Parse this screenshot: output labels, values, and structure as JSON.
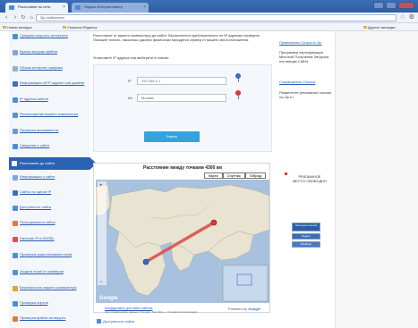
{
  "browser": {
    "tabs": [
      {
        "label": "Расстояние по сети"
      },
      {
        "label": "Яндекс.Интернетометр"
      }
    ],
    "url": "2ip.ru/distance/",
    "bookmarks": [
      {
        "label": "Новая вкладка"
      },
      {
        "label": "Сервисы Яндекса"
      },
      {
        "label": "Другие закладки"
      }
    ]
  },
  "leftnav": {
    "items": [
      {
        "label": "Средняя скорость интернета",
        "icon_color": "#4a8fd8"
      },
      {
        "label": "Время загрузки файла",
        "icon_color": "#7fa7d9"
      },
      {
        "label": "Объем интернет-трафика",
        "icon_color": "#9aaec9"
      },
      {
        "label": "Информация об IP адресе или домене",
        "icon_color": "#3b6fbf"
      },
      {
        "label": "IP адреса сайтов",
        "icon_color": "#4a8fd8"
      },
      {
        "label": "Расположение вашего компьютера",
        "icon_color": "#5b8fd0"
      },
      {
        "label": "Проверка анонимности",
        "icon_color": "#6b9ad6"
      },
      {
        "label": "Сведения о сайте",
        "icon_color": "#4a8fd8"
      },
      {
        "label": "Расстояние до сайта",
        "icon_color": "#ffffff"
      },
      {
        "label": "Информация о сайте",
        "icon_color": "#7fa7d9"
      },
      {
        "label": "Сайты на одном IP",
        "icon_color": "#3b6fbf"
      },
      {
        "label": "Доступность сайта",
        "icon_color": "#4a8fd8"
      },
      {
        "label": "Посещаемость сайта",
        "icon_color": "#e07b39"
      },
      {
        "label": "Наличие IP в DNSBL",
        "icon_color": "#d9534f"
      },
      {
        "label": "Проверка существования email",
        "icon_color": "#4a8fd8"
      },
      {
        "label": "Защита email от спамеров",
        "icon_color": "#5b8fd0"
      },
      {
        "label": "Безопасность вашего компьютера",
        "icon_color": "#e0a53a"
      },
      {
        "label": "Проверка портов",
        "icon_color": "#4a8fd8"
      },
      {
        "label": "Проверка файла на вирусы",
        "icon_color": "#e07b39"
      }
    ]
  },
  "content": {
    "intro": "Расстояние от вашего компьютера до сайта. Вычисляется приблизительно по IP адресам серверов. Поможет понять, насколько далеко физически находится сервер от вашего местоположения.",
    "instruction": "Установите IP адреса или выберите в списке:",
    "ip1": "192.168.1.1",
    "ip2": "Москва",
    "ip1_label": "IP",
    "ip2_label": "Из",
    "find_button": "Узнать",
    "map_title": "Расстояние между точками 4300 км",
    "map_buttons": [
      "Карта",
      "Спутник",
      "Гибрид"
    ],
    "map_footer_link": "Координаты для Web сайтов",
    "map_footer_text": "Картографические данные © Google, Tele Atlas — Условия использования",
    "powered_by_prefix": "Powered by",
    "powered_by_brand": "Google",
    "more_link": "Доступность сайта"
  },
  "rightcol": {
    "link1": "Правильная Скорость 2ip",
    "text1": "Программа сертификации Microsoft Получение Загрузка поставщик Сайта",
    "link2": "Сокращатель Ссылок",
    "text2": "Разместите рекламные ссылки на 2ip.ru",
    "ad_text": "РЕКЛАМНОЕ МЕСТО СВОБОДНО",
    "badge1": "Полезные ссылки",
    "badge2": "Яндекс",
    "badge3": "Рамблер"
  }
}
